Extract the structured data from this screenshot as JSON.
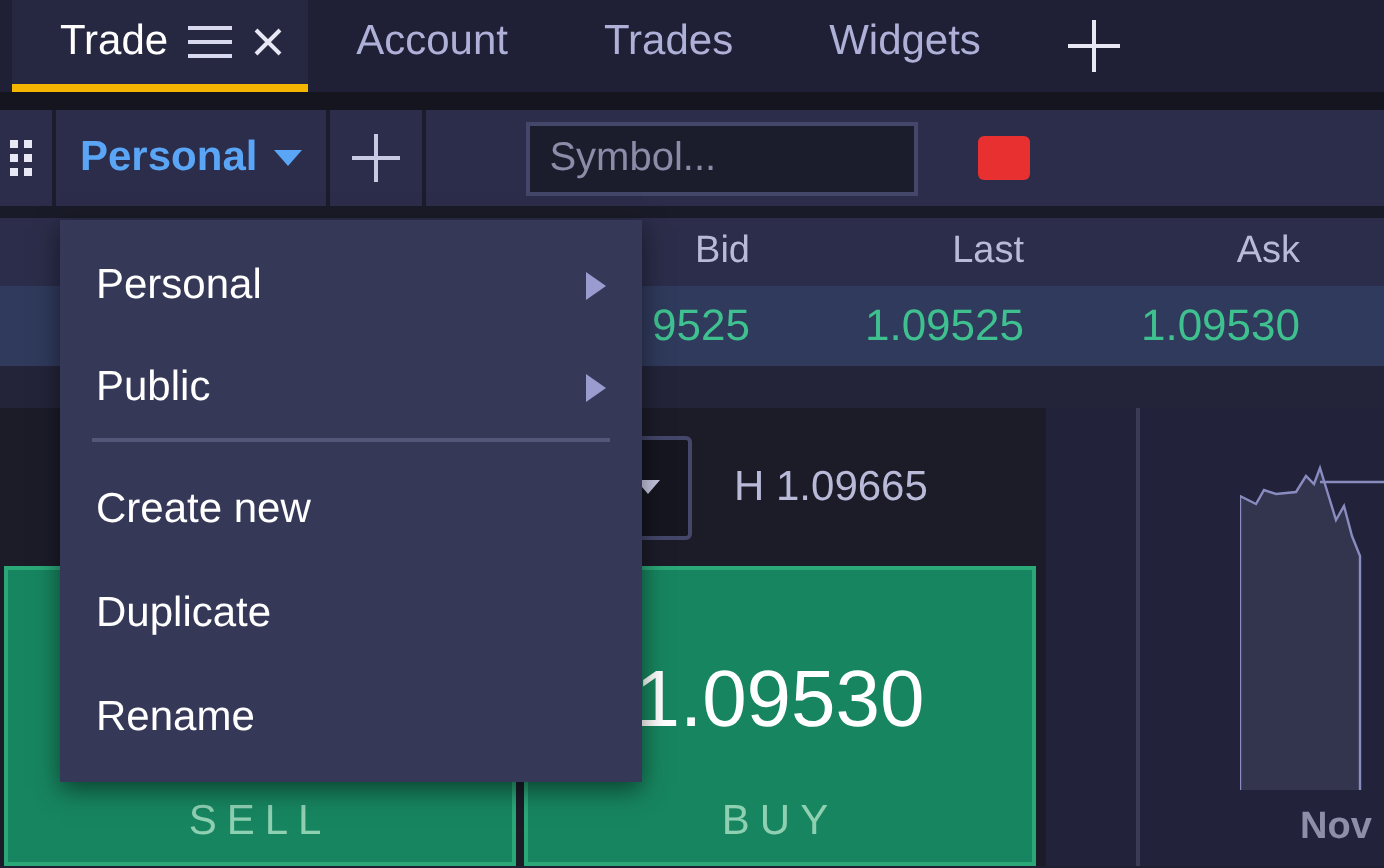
{
  "tabs": [
    {
      "label": "Trade",
      "selected": true
    },
    {
      "label": "Account",
      "selected": false
    },
    {
      "label": "Trades",
      "selected": false
    },
    {
      "label": "Widgets",
      "selected": false
    }
  ],
  "toolbar": {
    "layout": "Personal",
    "symbol_field": {
      "placeholder": "Symbol..."
    }
  },
  "quote_table": {
    "columns": [
      "Bid",
      "Last",
      "Ask"
    ],
    "row": [
      "9525",
      "1.09525",
      "1.09530"
    ]
  },
  "order_panel": {
    "high": "H 1.09665",
    "sell": {
      "label": "SELL"
    },
    "buy": {
      "price": "1.09530",
      "label": "BUY"
    }
  },
  "chart": {
    "x_label": "Nov"
  },
  "menu": [
    {
      "kind": "submenu",
      "label": "Personal"
    },
    {
      "kind": "submenu",
      "label": "Public"
    },
    {
      "kind": "separator"
    },
    {
      "kind": "action",
      "label": "Create new"
    },
    {
      "kind": "action",
      "label": "Duplicate"
    },
    {
      "kind": "action",
      "label": "Rename"
    }
  ]
}
